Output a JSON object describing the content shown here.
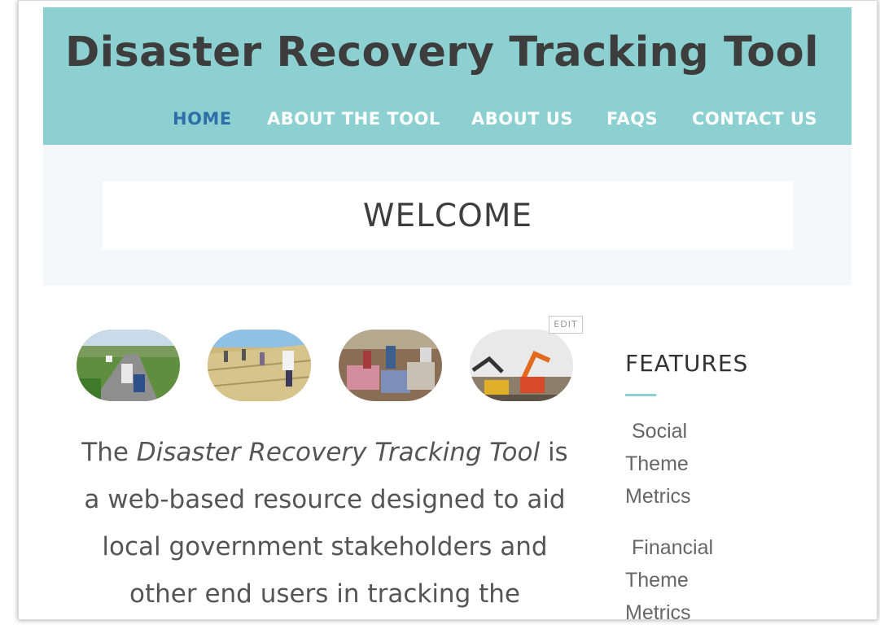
{
  "site": {
    "title": "Disaster Recovery Tracking Tool"
  },
  "nav": {
    "items": [
      {
        "label": "HOME",
        "active": true
      },
      {
        "label": "ABOUT THE TOOL",
        "active": false
      },
      {
        "label": "ABOUT US",
        "active": false
      },
      {
        "label": "FAQS",
        "active": false
      },
      {
        "label": "CONTACT US",
        "active": false
      }
    ]
  },
  "welcome": {
    "heading": "WELCOME"
  },
  "gallery": {
    "edit_label": "EDIT",
    "images": [
      {
        "subject": "highway-flooding-trucks"
      },
      {
        "subject": "volunteers-roof-repair"
      },
      {
        "subject": "workers-debris-sorting"
      },
      {
        "subject": "excavators-demolition"
      }
    ]
  },
  "intro": {
    "prefix": "The ",
    "tool_name": "Disaster Recovery Tracking Tool",
    "rest": " is a web-based resource designed to aid local government stakeholders and other end users in tracking the"
  },
  "features": {
    "heading": "FEATURES",
    "items": [
      {
        "lines": [
          "Social",
          "Theme",
          "Metrics"
        ]
      },
      {
        "lines": [
          "Financial",
          "Theme",
          "Metrics"
        ]
      }
    ]
  },
  "colors": {
    "header_bg": "#8dd0d1",
    "nav_active": "#2e6fa8",
    "nav_inactive": "#ffffff",
    "welcome_band": "#f5f7fb",
    "accent_rule": "#8dd0d1"
  }
}
